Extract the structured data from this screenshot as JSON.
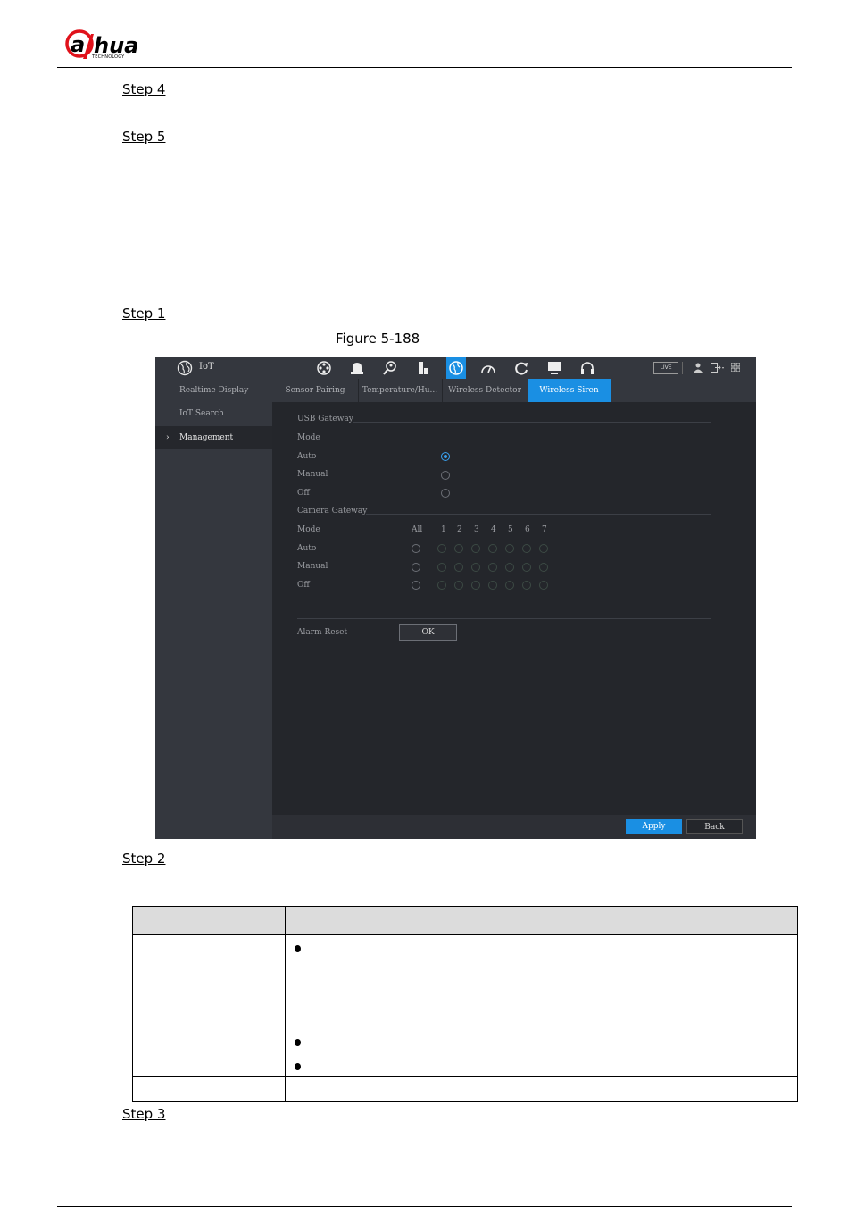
{
  "header": {
    "logo_text": "alhua",
    "logo_sub": "TECHNOLOGY"
  },
  "steps": [
    "Step 4",
    "Step 5",
    "Step 1",
    "Step 2",
    "Step 3"
  ],
  "figure_caption": "Figure 5-188",
  "screenshot": {
    "app_title": "IoT",
    "live_badge": "LIVE",
    "toolbar_icons": [
      "film-reel-icon",
      "alarm-bell-icon",
      "search-person-icon",
      "storage-icon",
      "globe-icon",
      "speed-gauge-icon",
      "refresh-icon",
      "monitor-icon",
      "headset-icon"
    ],
    "active_toolbar_icon": "globe-icon",
    "right_icons": [
      "user-icon",
      "logout-icon",
      "grid-icon"
    ],
    "sidebar": [
      {
        "label": "Realtime Display",
        "selected": false
      },
      {
        "label": "IoT Search",
        "selected": false
      },
      {
        "label": "Management",
        "selected": true
      }
    ],
    "tabs": [
      {
        "label": "Sensor Pairing",
        "selected": false
      },
      {
        "label": "Temperature/Hu...",
        "selected": false
      },
      {
        "label": "Wireless Detector",
        "selected": false
      },
      {
        "label": "Wireless Siren",
        "selected": true
      }
    ],
    "usb_gateway": {
      "section_title": "USB Gateway",
      "mode_label": "Mode",
      "options": [
        "Auto",
        "Manual",
        "Off"
      ],
      "selected": "Auto"
    },
    "camera_gateway": {
      "section_title": "Camera Gateway",
      "mode_label": "Mode",
      "all_label": "All",
      "channels": [
        "1",
        "2",
        "3",
        "4",
        "5",
        "6",
        "7"
      ],
      "options": [
        "Auto",
        "Manual",
        "Off"
      ]
    },
    "alarm_reset": {
      "label": "Alarm Reset",
      "button": "OK"
    },
    "footer": {
      "apply": "Apply",
      "back": "Back"
    },
    "colors": {
      "accent": "#1a8fe3",
      "background": "#24262b",
      "panel": "#34373e"
    }
  }
}
